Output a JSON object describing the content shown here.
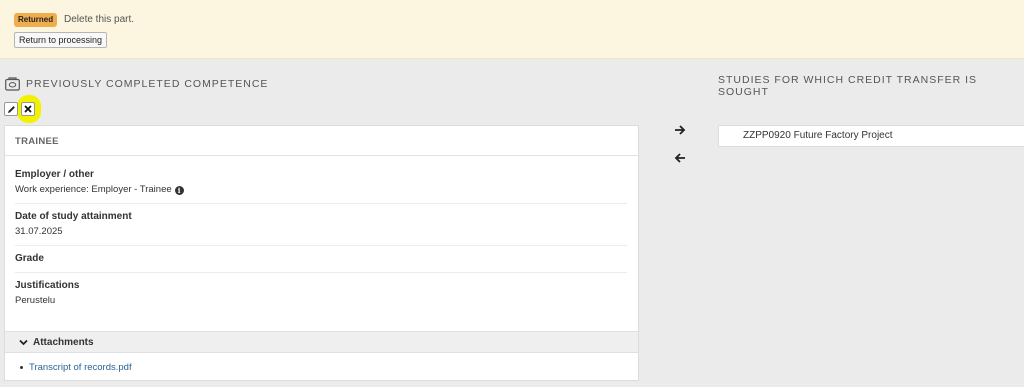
{
  "notice": {
    "badge": "Returned",
    "message": "Delete this part.",
    "return_button": "Return to processing"
  },
  "left_section": {
    "title": "PREVIOUSLY COMPLETED COMPETENCE",
    "card_title": "TRAINEE",
    "fields": [
      {
        "label": "Employer / other",
        "value": "Work experience: Employer - Trainee"
      },
      {
        "label": "Date of study attainment",
        "value": "31.07.2025"
      },
      {
        "label": "Grade",
        "value": ""
      },
      {
        "label": "Justifications",
        "value": "Perustelu"
      }
    ],
    "attachments_label": "Attachments",
    "attachments": [
      "Transcript of records.pdf"
    ]
  },
  "right_section": {
    "title": "STUDIES FOR WHICH CREDIT TRANSFER IS SOUGHT",
    "course": "ZZPP0920 Future Factory Project"
  },
  "colors": {
    "badge": "#f0ad4e",
    "notice_bg": "#fcf5df",
    "highlight": "#f2f200",
    "link": "#2a6496"
  }
}
